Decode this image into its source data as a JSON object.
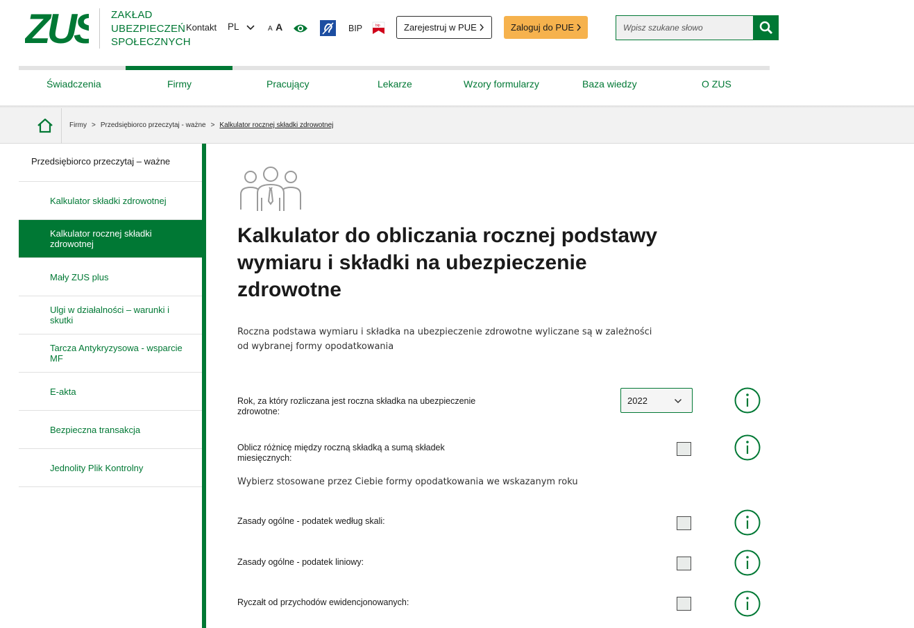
{
  "header": {
    "logo_text": "ZUS",
    "brand_lines": [
      "ZAKŁAD",
      "UBEZPIECZEŃ",
      "SPOŁECZNYCH"
    ],
    "contact_label": "Kontakt",
    "language": "PL",
    "font_small_label": "A",
    "font_big_label": "A",
    "bip_label": "BIP",
    "bip_icon_text": "bip",
    "register_label": "Zarejestruj w PUE",
    "login_label": "Zaloguj do PUE",
    "search_placeholder": "Wpisz szukane słowo",
    "icons": [
      "chevron-down-icon",
      "eye-icon",
      "deaf-icon",
      "bip-flag-icon",
      "chevron-right-icon",
      "search-icon"
    ]
  },
  "nav": {
    "items": [
      "Świadczenia",
      "Firmy",
      "Pracujący",
      "Lekarze",
      "Wzory formularzy",
      "Baza wiedzy",
      "O ZUS"
    ],
    "active_item": "Firmy"
  },
  "breadcrumb": {
    "items": [
      "Firmy",
      ">",
      "Przedsiębiorco przeczytaj - ważne",
      ">",
      "Kalkulator rocznej składki zdrowotnej"
    ]
  },
  "sidebar": {
    "title": "Przedsiębiorco przeczytaj – ważne",
    "items": [
      {
        "label": "Kalkulator składki zdrowotnej",
        "active": false
      },
      {
        "label": "Kalkulator rocznej składki zdrowotnej",
        "active": true
      },
      {
        "label": "Mały ZUS plus",
        "active": false
      },
      {
        "label": "Ulgi w działalności – warunki i skutki",
        "active": false
      },
      {
        "label": "Tarcza Antykryzysowa - wsparcie MF",
        "active": false
      },
      {
        "label": "E-akta",
        "active": false
      },
      {
        "label": "Bezpieczna transakcja",
        "active": false
      },
      {
        "label": "Jednolity Plik Kontrolny",
        "active": false
      }
    ]
  },
  "content": {
    "title": "Kalkulator do obliczania rocznej podstawy wymiaru i składki na ubezpieczenie zdrowotne",
    "intro": "Roczna podstawa wymiaru i składka na ubezpieczenie zdrowotne wyliczane są w zależności od wybranej formy opodatkowania",
    "year_question": "Rok, za który rozliczana jest roczna składka na ubezpieczenie zdrowotne:",
    "year_value": "2022",
    "difference_question": "Oblicz różnicę między roczną składką a sumą składek miesięcznych:",
    "tax_forms_note": "Wybierz stosowane przez Ciebie formy opodatkowania we wskazanym roku",
    "tax_options": [
      {
        "label": "Zasady ogólne - podatek według skali:",
        "checked": false
      },
      {
        "label": "Zasady ogólne - podatek liniowy:",
        "checked": false
      },
      {
        "label": "Ryczałt od przychodów ewidencjonowanych:",
        "checked": false
      }
    ],
    "difference_checked": false
  },
  "colors": {
    "brand_green": "#007834",
    "login_orange": "#f6b24d",
    "breadcrumb_bg": "#f2f2f2"
  }
}
